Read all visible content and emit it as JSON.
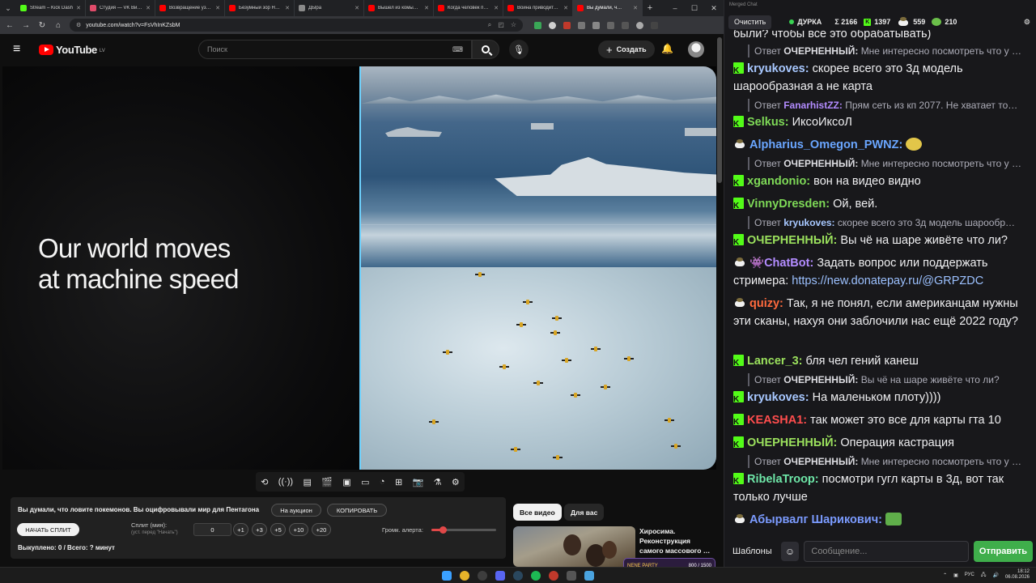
{
  "browser": {
    "tabs": [
      {
        "label": "Stream – Kick Dash",
        "color": "#53fc18"
      },
      {
        "label": "Студия — VK Вид…",
        "color": "#e04b6a"
      },
      {
        "label": "Возвращение уз…",
        "color": "#ff0000"
      },
      {
        "label": "Безумный зор Не…",
        "color": "#ff0000"
      },
      {
        "label": "ДЫра",
        "color": "#8a8a8a"
      },
      {
        "label": "Вышел из комы…",
        "color": "#ff0000"
      },
      {
        "label": "Когда человек по…",
        "color": "#ff0000"
      },
      {
        "label": "Война приводит…",
        "color": "#ff0000"
      },
      {
        "label": "Вы думали, ч…",
        "color": "#ff0000"
      }
    ],
    "url": "youtube.com/watch?v=FsVhInKZsbM"
  },
  "youtube": {
    "logo": "YouTube",
    "region": "LV",
    "search_placeholder": "Поиск",
    "create_label": "Создать"
  },
  "video": {
    "headline": "Our world moves\nat machine speed"
  },
  "extension": {
    "title": "Вы думали, что ловите покемонов. Вы оцифровывали мир для Пентагона",
    "auction_label": "На аукцион",
    "copy_label": "КОПИРОВАТЬ",
    "start_split_label": "НАЧАТЬ СПЛИТ",
    "split_label": "Сплит (мин):",
    "split_sublabel": "(уст. перед \"Начать\")",
    "split_value": "0",
    "increments": [
      "+1",
      "+3",
      "+5",
      "+10",
      "+20"
    ],
    "volume_label": "Громк. алерта:",
    "volume_fraction": 0.18,
    "status": "Выкуплено: 0 / Всего: ? минут"
  },
  "recommendations": {
    "chip_all": "Все видео",
    "chip_for_you": "Для вас",
    "video_title": "Хиросима.\nРеконструкция\nсамого массового …"
  },
  "chat": {
    "window_title": "Merged Chat",
    "clear_label": "Очистить",
    "channel": "ДУРКА",
    "total": "Σ 2166",
    "kick_count": "1397",
    "twitch_count": "559",
    "other_count": "210",
    "templates_label": "Шаблоны",
    "input_placeholder": "Сообщение...",
    "send_label": "Отправить",
    "colors": {
      "kryukoves": "#a8c8ff",
      "selkus": "#7ed957",
      "alpharius": "#6aa6ff",
      "xgandonio": "#7ed957",
      "vinny": "#7ed957",
      "ocher": "#9be15d",
      "chatbot": "#b38cff",
      "quizy": "#ff6a3d",
      "lancer": "#9be15d",
      "keasha": "#ff4d4d",
      "ribela": "#6ee7a8",
      "abyrvalg": "#7b9bff"
    },
    "messages": [
      {
        "text": "были? чтобы все это обрабатывать)"
      },
      {
        "reply_prefix": "Ответ",
        "reply_user": "ОЧЕРНЕННЫЙ:",
        "reply_text": "Мне интересно посмотреть что у …"
      },
      {
        "user": "kryukoves:",
        "text": "скорее всего это 3д модель шарообразная а не карта"
      },
      {
        "reply_prefix": "Ответ",
        "reply_user": "FanarhistZZ:",
        "reply_text": "Прям сеть из кп 2077. Не хватает то…"
      },
      {
        "user": "Selkus:",
        "text": "ИксоИксоЛ"
      },
      {
        "user": "Alpharius_Omegon_PWNZ:",
        "text": ""
      },
      {
        "reply_prefix": "Ответ",
        "reply_user": "ОЧЕРНЕННЫЙ:",
        "reply_text": "Мне интересно посмотреть что у …"
      },
      {
        "user": "xgandonio:",
        "text": "вон на видео видно"
      },
      {
        "user": "VinnyDresden:",
        "text": "Ой, вей."
      },
      {
        "reply_prefix": "Ответ",
        "reply_user": "kryukoves:",
        "reply_text": "скорее всего это 3д модель шарообр…"
      },
      {
        "user": "ОЧЕРНЕННЫЙ:",
        "text": "Вы чё на шаре живёте что ли?"
      },
      {
        "user": "ChatBot:",
        "text": "Задать вопрос или поддержать стримера:",
        "link": "https://new.donatepay.ru/@GRPZDC"
      },
      {
        "user": "quizy:",
        "text": "Так, я не понял, если американцам нужны эти сканы, нахуя они заблочили нас ещё 2022 году?"
      },
      {
        "user": "Lancer_3:",
        "text": "бля чел гений канеш"
      },
      {
        "reply_prefix": "Ответ",
        "reply_user": "ОЧЕРНЕННЫЙ:",
        "reply_text": "Вы чё на шаре живёте что ли?"
      },
      {
        "user": "kryukoves:",
        "text": "На маленьком плоту))))"
      },
      {
        "user": "KEASHA1:",
        "text": "так может это все для карты гта 10"
      },
      {
        "user": "ОЧЕРНЕННЫЙ:",
        "text": "Операция кастрация"
      },
      {
        "reply_prefix": "Ответ",
        "reply_user": "ОЧЕРНЕННЫЙ:",
        "reply_text": "Мне интересно посмотреть что у …"
      },
      {
        "user": "RibelaTroop:",
        "text": "посмотри гугл карты в 3д, вот так только лучше"
      },
      {
        "user": "Абырвалг Шарикович:",
        "text": ""
      }
    ]
  },
  "overlay": {
    "label": "NENE PARTY",
    "count": "800 / 1500"
  },
  "taskbar": {
    "lang": "РУС",
    "time": "18:12",
    "date": "06.08.2026"
  }
}
